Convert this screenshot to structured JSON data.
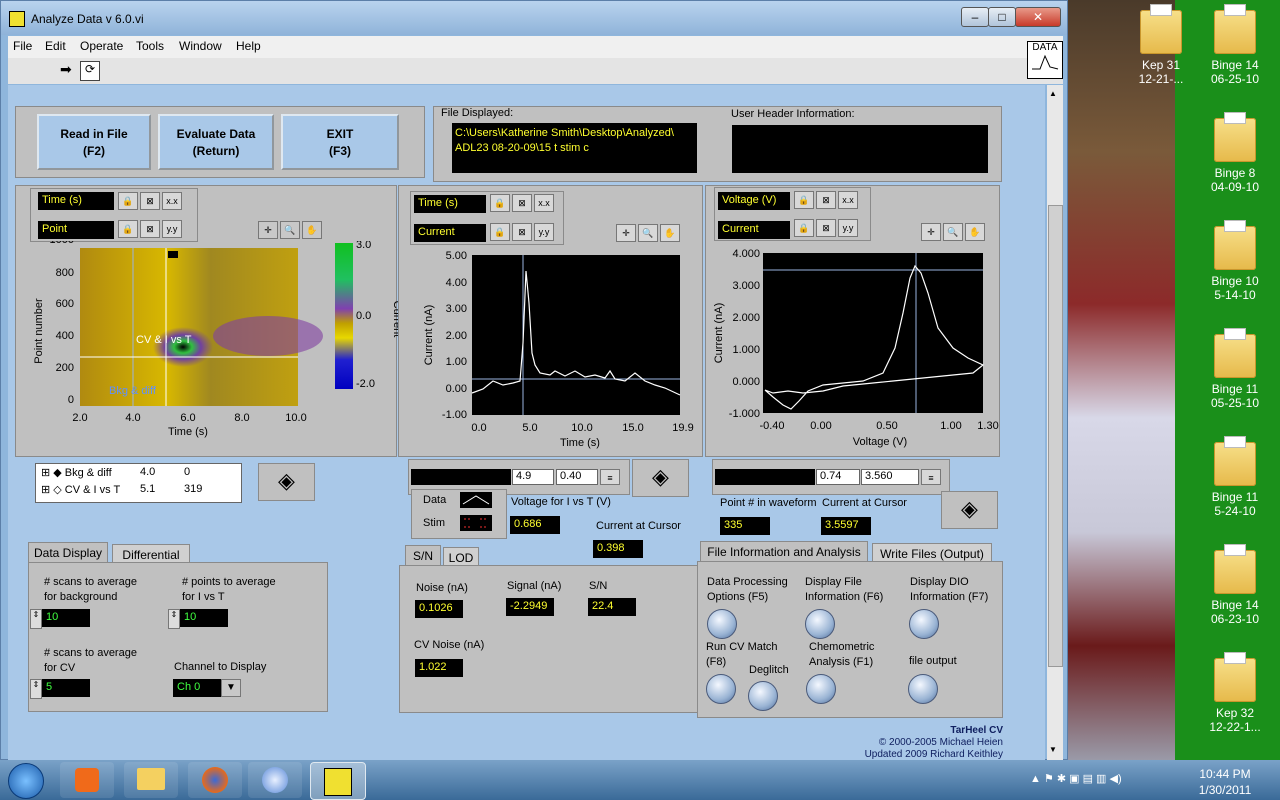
{
  "window": {
    "title": "Analyze Data v 6.0.vi",
    "data_icon_label": "DATA"
  },
  "menu": [
    "File",
    "Edit",
    "Operate",
    "Tools",
    "Window",
    "Help"
  ],
  "buttons": {
    "read": {
      "line1": "Read in File",
      "line2": "(F2)"
    },
    "evaluate": {
      "line1": "Evaluate Data",
      "line2": "(Return)"
    },
    "exit": {
      "line1": "EXIT",
      "line2": "(F3)"
    }
  },
  "file_displayed": {
    "label": "File Displayed:",
    "line1": "C:\\Users\\Katherine Smith\\Desktop\\Analyzed\\",
    "line2": "ADL23 08-20-09\\15 t stim c"
  },
  "user_header": {
    "label": "User Header Information:"
  },
  "colorplot": {
    "x_label_ctl": "Time (s)",
    "y_label_ctl": "Point",
    "ylabel": "Point number",
    "xlabel": "Time (s)",
    "xticks": [
      "2.0",
      "4.0",
      "6.0",
      "8.0",
      "10.0"
    ],
    "yticks": [
      "1000",
      "800",
      "600",
      "400",
      "200",
      "0"
    ],
    "cursor_cv": "CV & I vs T",
    "cursor_bkg": "Bkg & diff",
    "scale_ticks": [
      "3.0",
      "0.0",
      "-2.0"
    ],
    "scale_label": "Current"
  },
  "cursor_list": [
    {
      "name": "Bkg & diff",
      "x": "4.0",
      "y": "0"
    },
    {
      "name": "CV & I vs T",
      "x": "5.1",
      "y": "319"
    }
  ],
  "it_plot": {
    "x_label_ctl": "Time (s)",
    "y_label_ctl": "Current",
    "ylabel": "Current (nA)",
    "xlabel": "Time (s)",
    "yticks": [
      "5.00",
      "4.00",
      "3.00",
      "2.00",
      "1.00",
      "0.00",
      "-1.00"
    ],
    "xticks": [
      "0.0",
      "5.0",
      "10.0",
      "15.0",
      "19.9"
    ],
    "cursor_x": "4.9",
    "cursor_y": "0.40"
  },
  "cv_plot": {
    "x_label_ctl": "Voltage (V)",
    "y_label_ctl": "Current",
    "ylabel": "Current (nA)",
    "xlabel": "Voltage (V)",
    "yticks": [
      "4.000",
      "3.000",
      "2.000",
      "1.000",
      "0.000",
      "-1.000"
    ],
    "xticks": [
      "-0.40",
      "0.00",
      "0.50",
      "1.00",
      "1.30"
    ],
    "cursor_x": "0.74",
    "cursor_y": "3.560"
  },
  "legend": {
    "data": "Data",
    "stim": "Stim"
  },
  "voltage_for_i_vs_t": {
    "label": "Voltage for I vs T (V)",
    "value": "0.686"
  },
  "current_at_cursor_mid": {
    "label": "Current at Cursor",
    "value": "0.398"
  },
  "point_in_waveform": {
    "label": "Point # in waveform",
    "value": "335"
  },
  "current_at_cursor_right": {
    "label": "Current at Cursor",
    "value": "3.5597"
  },
  "tabs_left": [
    "Data Display",
    "Differential"
  ],
  "data_display": {
    "bg_label1": "# scans to average",
    "bg_label2": "for background",
    "bg_value": "10",
    "pt_label1": "# points to average",
    "pt_label2": "for I vs T",
    "pt_value": "10",
    "cv_label1": "# scans to average",
    "cv_label2": "for CV",
    "cv_value": "5",
    "channel_label": "Channel to Display",
    "channel_value": "Ch 0"
  },
  "tabs_mid": [
    "S/N",
    "LOD"
  ],
  "sn": {
    "noise_label": "Noise (nA)",
    "noise_value": "0.1026",
    "signal_label": "Signal (nA)",
    "signal_value": "-2.2949",
    "sn_label": "S/N",
    "sn_value": "22.4",
    "cvnoise_label": "CV Noise (nA)",
    "cvnoise_value": "1.022"
  },
  "tabs_right": [
    "File Information and Analysis",
    "Write Files (Output)"
  ],
  "file_info": {
    "dpo1": "Data Processing",
    "dpo2": "Options (F5)",
    "dfi1": "Display File",
    "dfi2": "Information (F6)",
    "dio1": "Display DIO",
    "dio2": "Information (F7)",
    "cvm1": "Run CV Match",
    "cvm2": "(F8)",
    "chemo1": "Chemometric",
    "chemo2": "Analysis (F1)",
    "deglitch": "Deglitch",
    "fileout": "file output"
  },
  "footer": {
    "l1": "TarHeel CV",
    "l2": "© 2000-2005 Michael Heien",
    "l3": "Updated 2009 Richard Keithley"
  },
  "desktop_icons": [
    {
      "l1": "Kep 31",
      "l2": "12-21-..."
    },
    {
      "l1": "Binge 14",
      "l2": "06-25-10"
    },
    {
      "l1": "Binge 8",
      "l2": "04-09-10"
    },
    {
      "l1": "Binge 10",
      "l2": "5-14-10"
    },
    {
      "l1": "Binge 11",
      "l2": "05-25-10"
    },
    {
      "l1": "Binge 11",
      "l2": "5-24-10"
    },
    {
      "l1": "Binge 14",
      "l2": "06-23-10"
    },
    {
      "l1": "Kep 32",
      "l2": "12-22-1..."
    }
  ],
  "clock": {
    "time": "10:44 PM",
    "date": "1/30/2011"
  }
}
